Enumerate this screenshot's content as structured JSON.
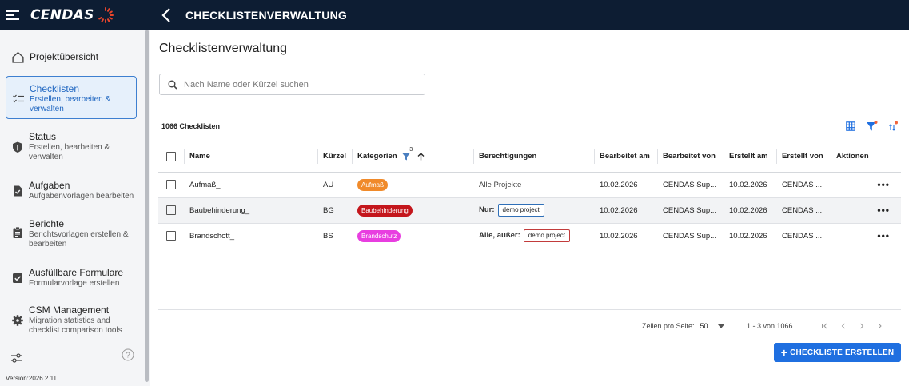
{
  "app": {
    "brand": "CENDAS",
    "title": "CHECKLISTENVERWALTUNG"
  },
  "sidebar": {
    "items": [
      {
        "title": "Projektübersicht",
        "sub": ""
      },
      {
        "title": "Checklisten",
        "sub": "Erstellen, bearbeiten & verwalten"
      },
      {
        "title": "Status",
        "sub": "Erstellen, bearbeiten & verwalten"
      },
      {
        "title": "Aufgaben",
        "sub": "Aufgabenvorlagen bearbeiten"
      },
      {
        "title": "Berichte",
        "sub": "Berichtsvorlagen erstellen & bearbeiten"
      },
      {
        "title": "Ausfüllbare Formulare",
        "sub": "Formularvorlage erstellen"
      },
      {
        "title": "CSM Management",
        "sub": "Migration statistics and checklist comparison tools"
      }
    ],
    "version": "Version:2026.2.11"
  },
  "main": {
    "title": "Checklistenverwaltung",
    "search_placeholder": "Nach Name oder Kürzel suchen",
    "count": "1066 Checklisten",
    "filter_count": "3"
  },
  "table": {
    "headers": [
      "Name",
      "Kürzel",
      "Kategorien",
      "Berechtigungen",
      "Bearbeitet am",
      "Bearbeitet von",
      "Erstellt am",
      "Erstellt von",
      "Aktionen"
    ],
    "rows": [
      {
        "name": "Aufmaß_",
        "short": "AU",
        "category": "Aufmaß",
        "category_color": "#f08a2a",
        "perm_label": "Alle Projekte",
        "perm_tag": "",
        "edited_on": "10.02.2026",
        "edited_by": "CENDAS Sup...",
        "created_on": "10.02.2026",
        "created_by": "CENDAS ...",
        "actions": "•••"
      },
      {
        "name": "Baubehinderung_",
        "short": "BG",
        "category": "Baubehinderung",
        "category_color": "#c4161c",
        "perm_label": "Nur:",
        "perm_tag": "demo project",
        "edited_on": "10.02.2026",
        "edited_by": "CENDAS Sup...",
        "created_on": "10.02.2026",
        "created_by": "CENDAS ...",
        "actions": "•••"
      },
      {
        "name": "Brandschott_",
        "short": "BS",
        "category": "Brandschutz",
        "category_color": "#e83ee0",
        "perm_label": "Alle, außer:",
        "perm_tag": "demo project",
        "edited_on": "10.02.2026",
        "edited_by": "CENDAS Sup...",
        "created_on": "10.02.2026",
        "created_by": "CENDAS ...",
        "actions": "•••"
      }
    ]
  },
  "pagination": {
    "rows_per_page_label": "Zeilen pro Seite:",
    "rows_per_page": "50",
    "range": "1 - 3 von 1066"
  },
  "actions": {
    "create": "CHECKLISTE ERSTELLEN"
  },
  "colors": {
    "topbar": "#0d1d33",
    "accent": "#1f6fe0",
    "active_nav": "#1f66c1"
  }
}
